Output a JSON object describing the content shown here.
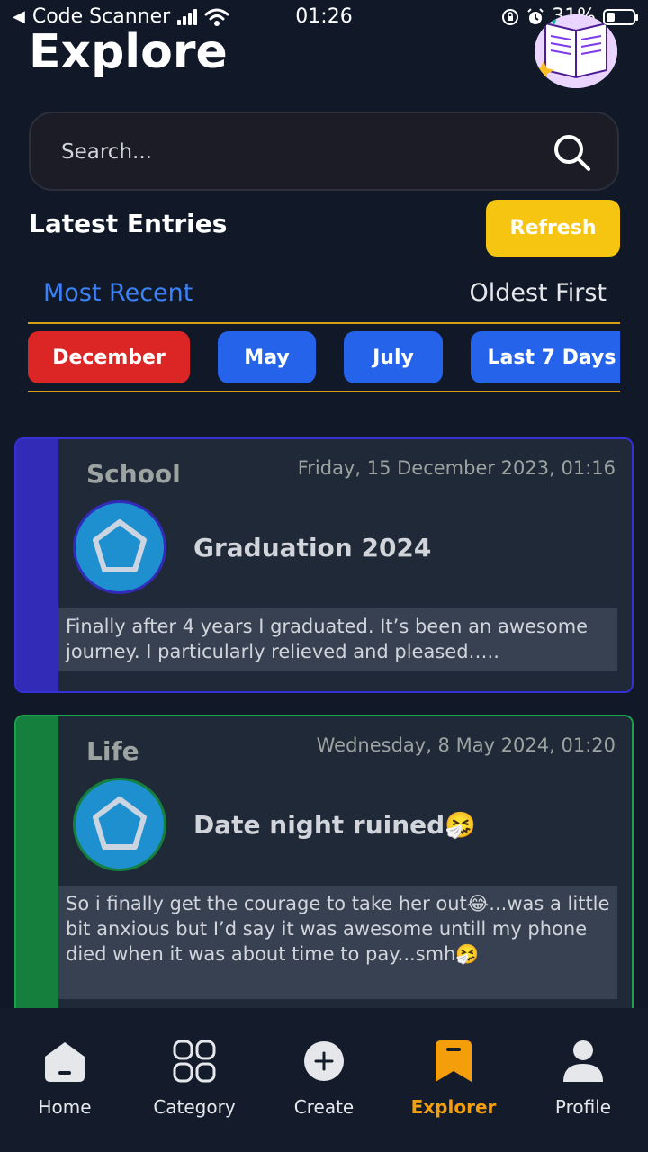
{
  "status_bar": {
    "back_app": "Code Scanner",
    "time": "01:26",
    "battery": "31%"
  },
  "header": {
    "title": "Explore"
  },
  "search": {
    "placeholder": "Search..."
  },
  "entries_section": {
    "title": "Latest Entries",
    "refresh_label": "Refresh"
  },
  "sort_tabs": [
    {
      "label": "Most Recent",
      "active": true
    },
    {
      "label": "Oldest First",
      "active": false
    }
  ],
  "filters": [
    {
      "label": "December",
      "color": "#dc2626"
    },
    {
      "label": "May",
      "color": "#2563eb"
    },
    {
      "label": "July",
      "color": "#2563eb"
    },
    {
      "label": "Last 7 Days",
      "color": "#2563eb"
    }
  ],
  "entries": [
    {
      "category": "School",
      "date": "Friday, 15 December 2023, 01:16",
      "title": "Graduation 2024",
      "excerpt": "Finally after 4 years I graduated. It’s been an awesome journey. I particularly relieved and pleased…..",
      "color": "#312bb8"
    },
    {
      "category": "Life",
      "date": "Wednesday, 8 May 2024, 01:20",
      "title": "Date night ruined🤧",
      "excerpt": "So i finally get the courage to take her out😂...was a little bit anxious but I’d say it was awesome untill my phone died when it was about time to pay...smh🤧",
      "color": "#15803d"
    }
  ],
  "bottom_nav": [
    {
      "label": "Home",
      "icon": "home-icon"
    },
    {
      "label": "Category",
      "icon": "grid-icon"
    },
    {
      "label": "Create",
      "icon": "plus-circle-icon"
    },
    {
      "label": "Explorer",
      "icon": "bookmark-icon",
      "active": true
    },
    {
      "label": "Profile",
      "icon": "person-icon"
    }
  ],
  "colors": {
    "background": "#111827",
    "accent": "#f6c512",
    "active_nav": "#f59e0b",
    "link": "#3b82f6"
  }
}
